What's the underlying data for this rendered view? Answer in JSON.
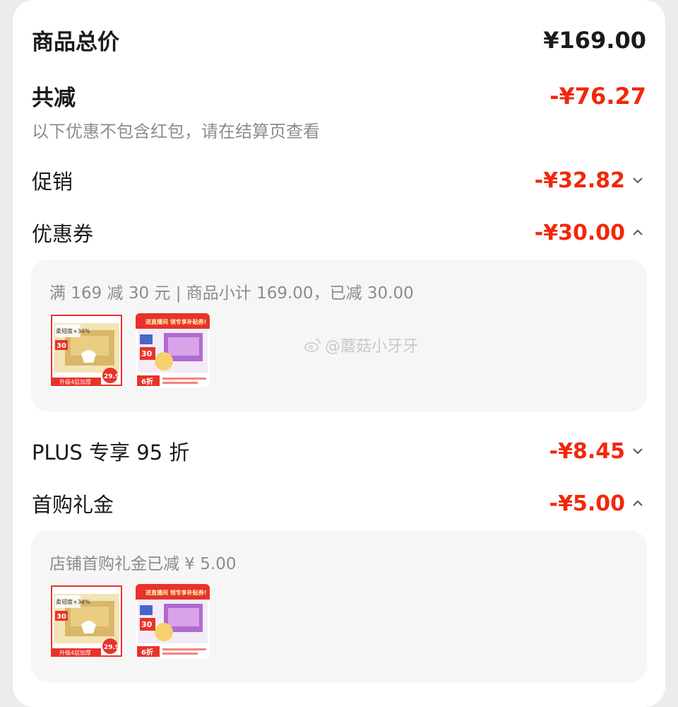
{
  "total": {
    "label": "商品总价",
    "amount": "¥169.00"
  },
  "reduction": {
    "label": "共减",
    "amount": "-¥76.27",
    "note": "以下优惠不包含红包，请在结算页查看"
  },
  "promo": {
    "label": "促销",
    "amount": "-¥32.82",
    "chevron": "chevron-down-icon"
  },
  "coupon": {
    "label": "优惠券",
    "amount": "-¥30.00",
    "chevron": "chevron-up-icon",
    "detail": "满 169 减 30 元 | 商品小计 169.00，已减 30.00",
    "products": [
      {
        "badge": "30",
        "tag": "升级4层加厚",
        "price_tag": "29.9",
        "title": "柔韧度+34%"
      },
      {
        "badge": "30",
        "tag": "6折",
        "title": "进直播间 领专享补贴券!"
      }
    ]
  },
  "plus": {
    "label": "PLUS 专享 95 折",
    "amount": "-¥8.45",
    "chevron": "chevron-down-icon"
  },
  "first_buy": {
    "label": "首购礼金",
    "amount": "-¥5.00",
    "chevron": "chevron-up-icon",
    "detail": "店铺首购礼金已减 ¥ 5.00",
    "products": [
      {
        "badge": "30",
        "tag": "升级4层加厚",
        "price_tag": "29.9",
        "title": "柔韧度+34%"
      },
      {
        "badge": "30",
        "tag": "6折",
        "title": "进直播间 领专享补贴券!"
      }
    ]
  },
  "watermark": {
    "text": "@蘑菇小牙牙",
    "icon": "weibo-icon"
  },
  "colors": {
    "accent": "#f2270c",
    "text": "#1a1a1a",
    "muted": "#8c8c8c",
    "panel": "#f6f6f6"
  }
}
